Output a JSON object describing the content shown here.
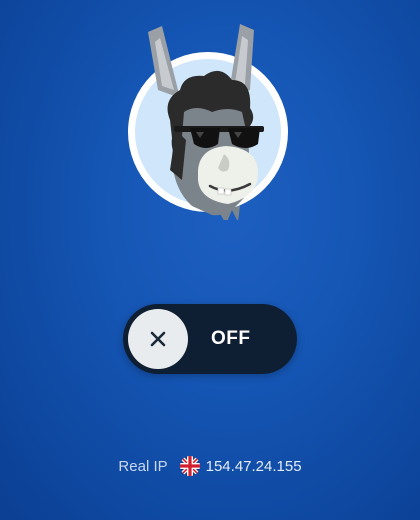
{
  "mascot": {
    "icon": "donkey-mascot-icon"
  },
  "vpn_toggle": {
    "state_label": "OFF",
    "knob_icon": "close-icon"
  },
  "ip_info": {
    "label": "Real IP",
    "flag_icon": "uk-flag-icon",
    "address": "154.47.24.155"
  },
  "colors": {
    "background": "#1657b6",
    "toggle_bg": "#0f1f33",
    "knob_bg": "#e9ecef"
  }
}
